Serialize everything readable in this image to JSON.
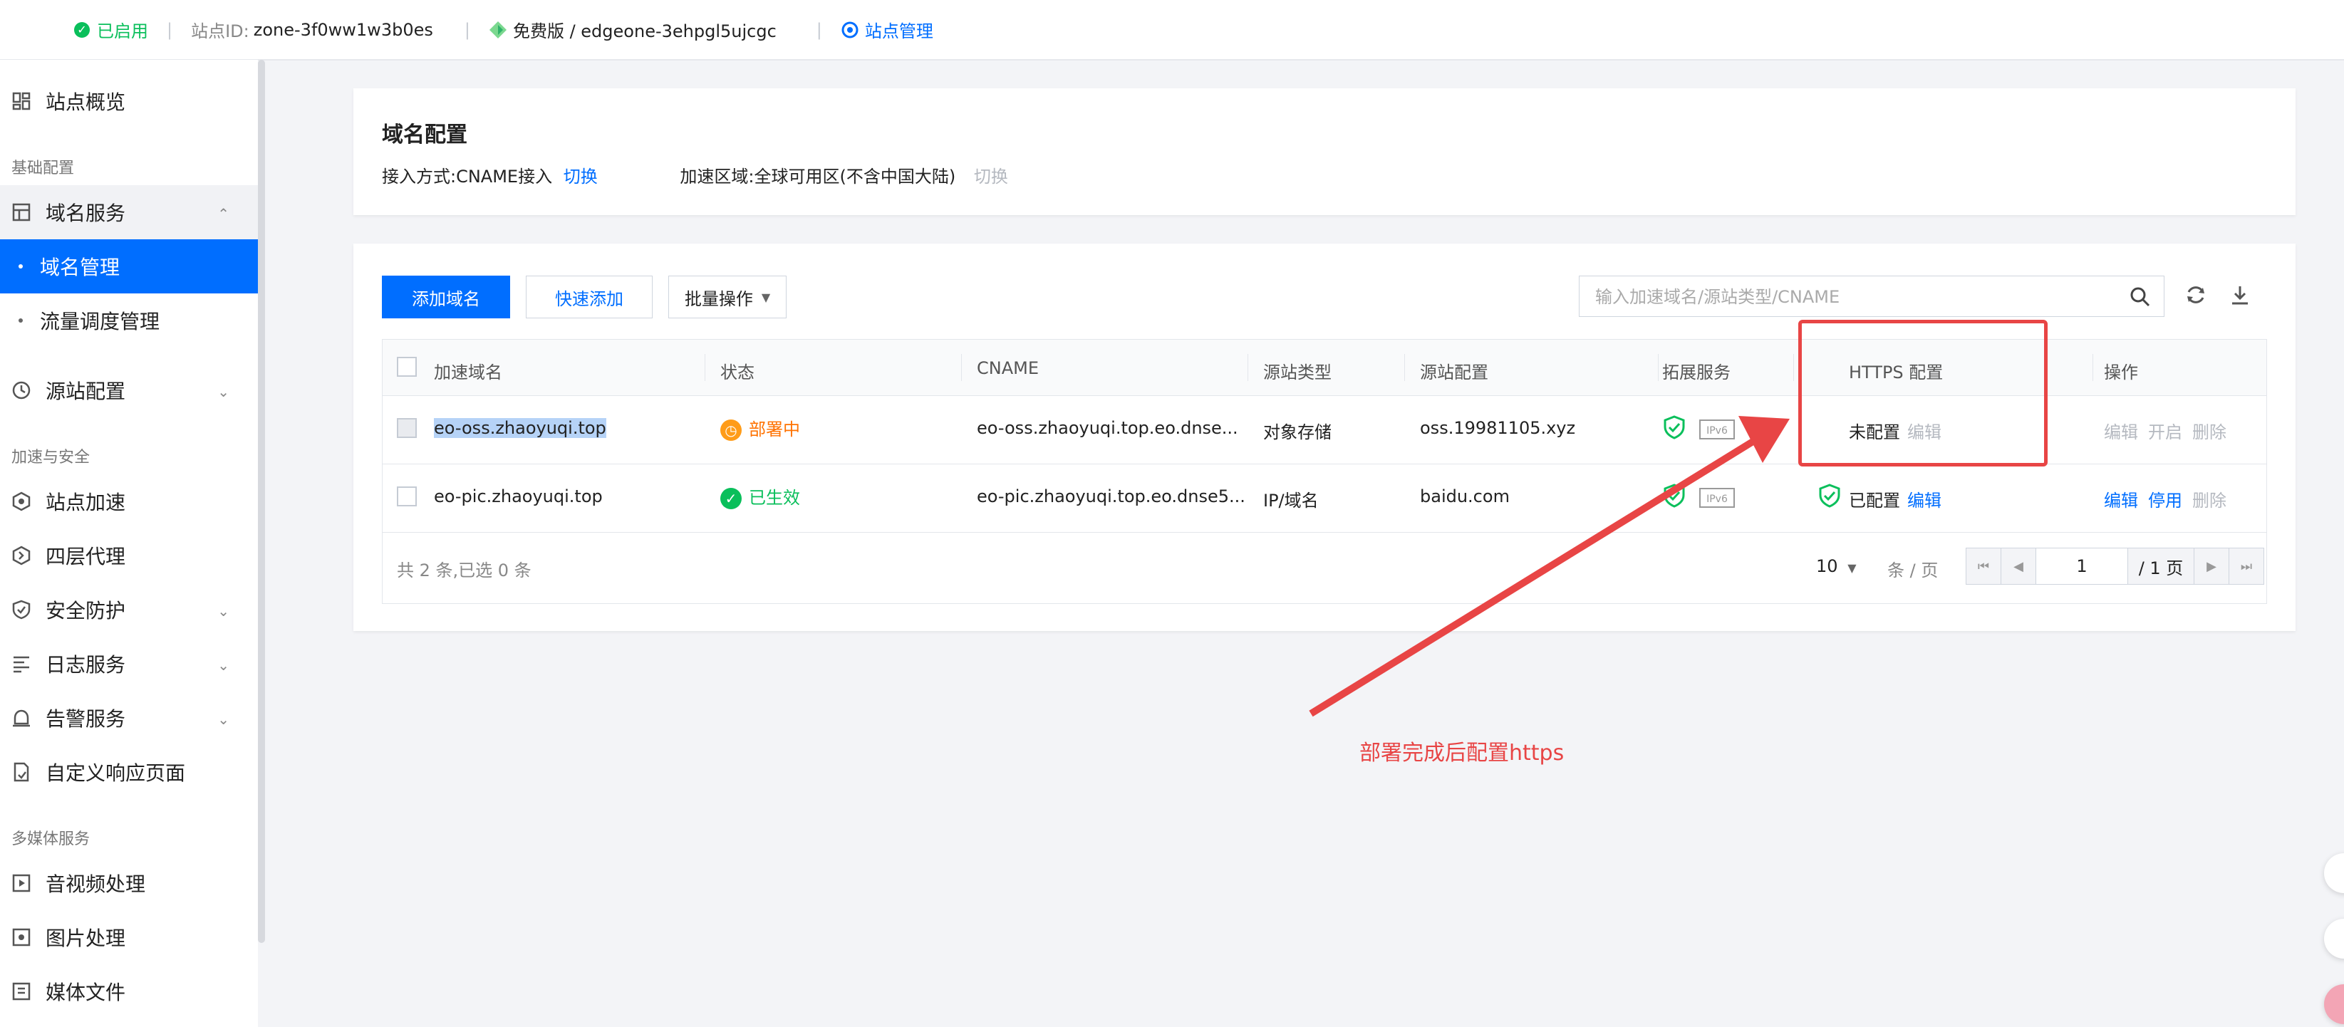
{
  "topbar": {
    "status": "已启用",
    "zone_label": "站点ID:",
    "zone_id": "zone-3f0ww1w3b0es",
    "plan": "免费版 / edgeone-3ehpgl5ujcgc",
    "manage": "站点管理"
  },
  "sidebar": {
    "overview": "站点概览",
    "group_basic": "基础配置",
    "domain_service": "域名服务",
    "domain_manage": "域名管理",
    "traffic_schedule": "流量调度管理",
    "origin_config": "源站配置",
    "group_security": "加速与安全",
    "site_accel": "站点加速",
    "l4_proxy": "四层代理",
    "security": "安全防护",
    "log_service": "日志服务",
    "alarm_service": "告警服务",
    "custom_page": "自定义响应页面",
    "group_media": "多媒体服务",
    "av_process": "音视频处理",
    "image_process": "图片处理",
    "media_files": "媒体文件"
  },
  "config_card": {
    "title": "域名配置",
    "access_label": "接入方式:",
    "access_value": "CNAME接入",
    "access_switch": "切换",
    "region_label": "加速区域:",
    "region_value": "全球可用区(不含中国大陆)",
    "region_switch": "切换"
  },
  "toolbar": {
    "add_domain": "添加域名",
    "quick_add": "快速添加",
    "bulk_ops": "批量操作",
    "search_placeholder": "输入加速域名/源站类型/CNAME"
  },
  "table": {
    "headers": [
      "加速域名",
      "状态",
      "CNAME",
      "源站类型",
      "源站配置",
      "拓展服务",
      "HTTPS 配置",
      "操作"
    ],
    "rows": [
      {
        "domain": "eo-oss.zhaoyuqi.top",
        "status": "部署中",
        "cname": "eo-oss.zhaoyuqi.top.eo.dnse...",
        "origin_type": "对象存储",
        "origin_config": "oss.19981105.xyz",
        "ipv6": "IPv6",
        "https": "未配置",
        "https_edit": "编辑",
        "op_edit": "编辑",
        "op_toggle": "开启",
        "op_delete": "删除"
      },
      {
        "domain": "eo-pic.zhaoyuqi.top",
        "status": "已生效",
        "cname": "eo-pic.zhaoyuqi.top.eo.dnse5...",
        "origin_type": "IP/域名",
        "origin_config": "baidu.com",
        "ipv6": "IPv6",
        "https": "已配置",
        "https_edit": "编辑",
        "op_edit": "编辑",
        "op_toggle": "停用",
        "op_delete": "删除"
      }
    ],
    "summary": "共 2 条,已选 0 条",
    "page_size": "10",
    "page_size_unit": "条 / 页",
    "page_current": "1",
    "page_total": "/ 1 页"
  },
  "annotation": {
    "text": "部署完成后配置https"
  },
  "colors": {
    "primary": "#006eff",
    "success": "#0abf5b",
    "warning": "#ff7200",
    "annotation": "#e84545"
  }
}
